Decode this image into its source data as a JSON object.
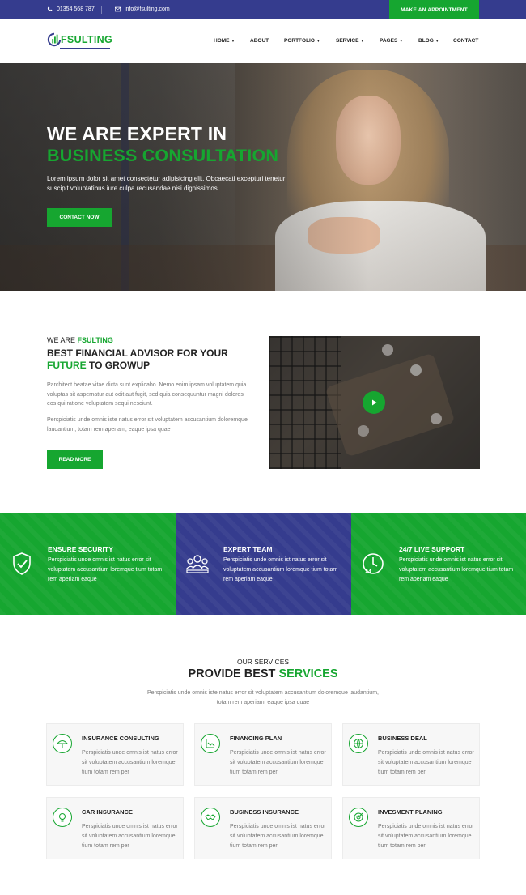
{
  "topbar": {
    "phone": "01354 568 787",
    "email": "info@fsulting.com",
    "cta": "MAKE AN APPOINTMENT"
  },
  "brand": {
    "name": "FSULTING"
  },
  "menu": [
    {
      "label": "HOME",
      "dropdown": true
    },
    {
      "label": "ABOUT",
      "dropdown": false
    },
    {
      "label": "PORTFOLIO",
      "dropdown": true
    },
    {
      "label": "SERVICE",
      "dropdown": true
    },
    {
      "label": "PAGES",
      "dropdown": true
    },
    {
      "label": "BLOG",
      "dropdown": true
    },
    {
      "label": "CONTACT",
      "dropdown": false
    }
  ],
  "hero": {
    "title_line1": "WE ARE EXPERT IN",
    "title_line2": "BUSINESS CONSULTATION",
    "text": "Lorem ipsum dolor sit amet consectetur adipisicing elit. Obcaecati excepturi tenetur suscipit voluptatibus iure culpa recusandae nisi dignissimos.",
    "button": "CONTACT NOW"
  },
  "about": {
    "kicker_prefix": "WE ARE",
    "kicker_brand": "FSULTING",
    "heading_part1": "BEST FINANCIAL ADVISOR FOR YOUR",
    "heading_highlight": "FUTURE",
    "heading_part2": "TO GROWUP",
    "paragraph1": "Parchitect beatae vitae dicta sunt explicabo. Nemo enim ipsam voluptatem quia voluptas sit aspernatur aut odit aut fugit, sed quia consequuntur magni dolores eos qui ratione voluptatem sequi nesciunt.",
    "paragraph2": "Perspiciatis unde omnis iste natus error sit voluptatem accusantium doloremque laudantium, totam rem aperiam, eaque ipsa quae",
    "button": "READ MORE"
  },
  "features": [
    {
      "title": "ENSURE SECURITY",
      "text": "Perspiciatis unde omnis ist natus error sit voluptatem accusantium loremque tium totam rem aperiam eaque",
      "icon": "shield-check-icon",
      "color": "#16a630"
    },
    {
      "title": "EXPERT TEAM",
      "text": "Perspiciatis unde omnis ist natus error sit voluptatem accusantium loremque tium totam rem aperiam eaque",
      "icon": "team-icon",
      "color": "#353c8e"
    },
    {
      "title": "24/7 LIVE SUPPORT",
      "text": "Perspiciatis unde omnis ist natus error sit voluptatem accusantium loremque tium totam rem aperiam eaque",
      "icon": "clock-24-icon",
      "color": "#16a630"
    }
  ],
  "services": {
    "kicker": "OUR SERVICES",
    "title_part1": "PROVIDE BEST",
    "title_highlight": "SERVICES",
    "subtitle": "Perspiciatis unde omnis iste natus error sit voluptatem accusantium doloremque laudantium, totam rem aperiam, eaque ipsa quae",
    "items": [
      {
        "title": "INSURANCE CONSULTING",
        "text": "Perspiciatis unde omnis ist natus error sit voluptatem accusantium loremque tium totam rem per",
        "icon": "umbrella-icon"
      },
      {
        "title": "FINANCING PLAN",
        "text": "Perspiciatis unde omnis ist natus error sit voluptatem accusantium loremque tium totam rem per",
        "icon": "chart-icon"
      },
      {
        "title": "BUSINESS DEAL",
        "text": "Perspiciatis unde omnis ist natus error sit voluptatem accusantium loremque tium totam rem per",
        "icon": "globe-icon"
      },
      {
        "title": "CAR INSURANCE",
        "text": "Perspiciatis unde omnis ist natus error sit voluptatem accusantium loremque tium totam rem per",
        "icon": "lightbulb-icon"
      },
      {
        "title": "BUSINESS INSURANCE",
        "text": "Perspiciatis unde omnis ist natus error sit voluptatem accusantium loremque tium totam rem per",
        "icon": "handshake-icon"
      },
      {
        "title": "INVESMENT PLANING",
        "text": "Perspiciatis unde omnis ist natus error sit voluptatem accusantium loremque tium totam rem per",
        "icon": "target-icon"
      }
    ]
  },
  "colors": {
    "brand_green": "#16a630",
    "brand_navy": "#353c8e"
  }
}
